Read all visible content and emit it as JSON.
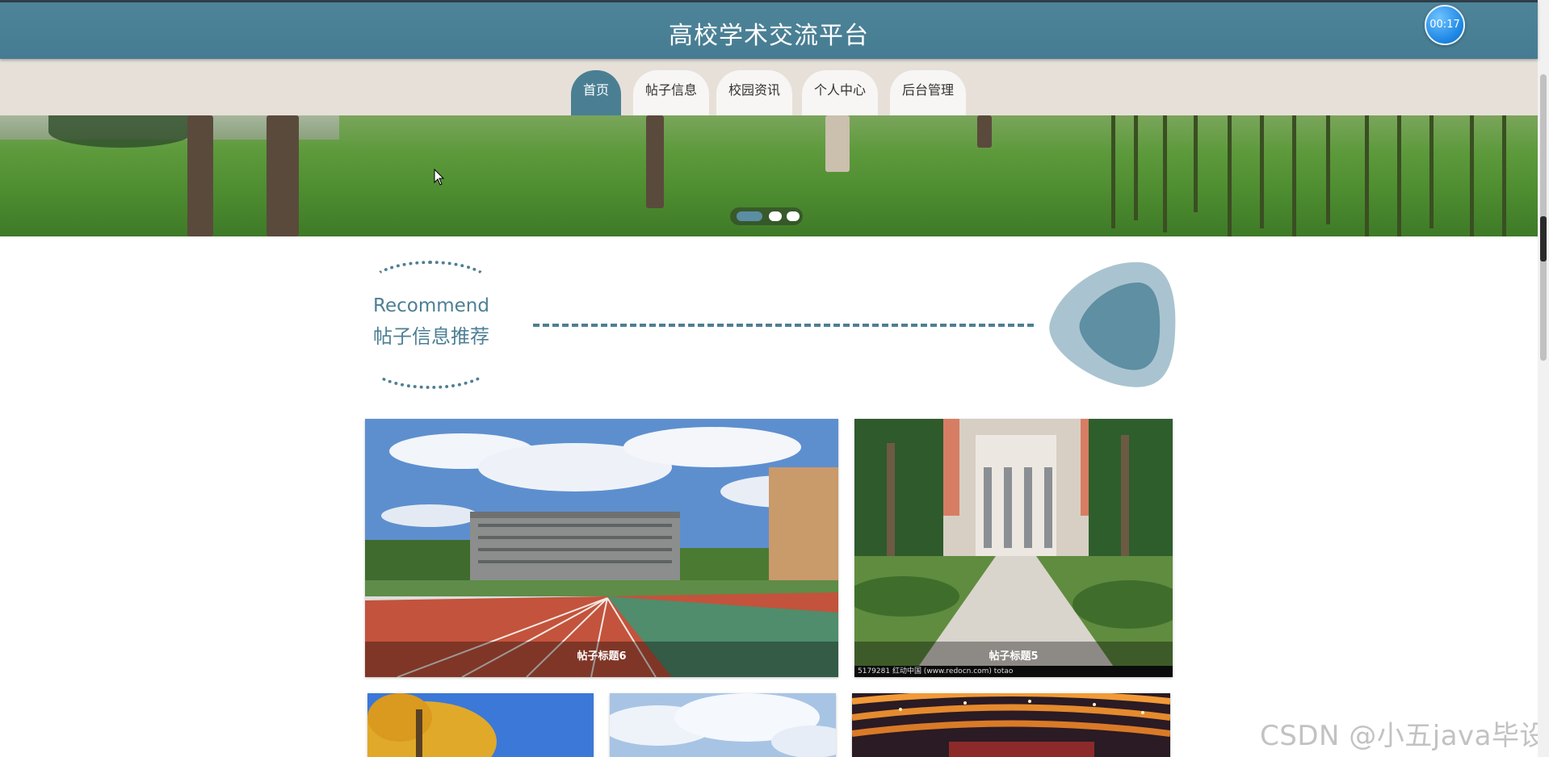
{
  "header": {
    "title": "高校学术交流平台",
    "timer": "00:17"
  },
  "nav": {
    "items": [
      {
        "label": "首页",
        "active": true
      },
      {
        "label": "帖子信息",
        "active": false
      },
      {
        "label": "校园资讯",
        "active": false
      },
      {
        "label": "个人中心",
        "active": false
      },
      {
        "label": "后台管理",
        "active": false
      }
    ]
  },
  "banner": {
    "slide_count": 3,
    "active_slide": 1
  },
  "recommend": {
    "title_en": "Recommend",
    "title_zh": "帖子信息推荐"
  },
  "posts": [
    {
      "caption": "帖子标题6",
      "image": "running-track-campus-photo"
    },
    {
      "caption": "帖子标题5",
      "image": "palm-lined-campus-walkway-photo",
      "credit": "5179281    红动中国 (www.redocn.com)    totao"
    },
    {
      "caption": "",
      "image": "ginkgo-tree-blue-sky-photo"
    },
    {
      "caption": "",
      "image": "cloudy-sky-photo"
    },
    {
      "caption": "",
      "image": "auditorium-stage-photo"
    }
  ],
  "watermark": "CSDN @小五java毕设",
  "colors": {
    "primary": "#4a7f93",
    "nav_bg": "#e7e0d9",
    "accent_light": "#a9c4d0"
  }
}
